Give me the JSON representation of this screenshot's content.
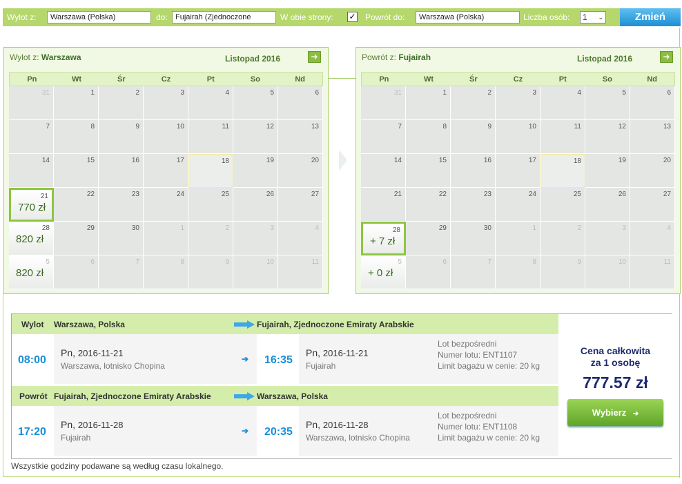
{
  "search": {
    "from_label": "Wylot z:",
    "from_value": "Warszawa (Polska)",
    "to_label": "do:",
    "to_value": "Fujairah (Zjednoczone",
    "roundtrip_label": "W obie strony:",
    "roundtrip_check": "✓",
    "return_label": "Powrót do:",
    "return_value": "Warszawa (Polska)",
    "persons_label": "Liczba osób:",
    "persons_value": "1",
    "change_button": "Zmień"
  },
  "outbound_cal": {
    "from_prefix": "Wylot z:",
    "from_city": "Warszawa",
    "month": "Listopad 2016",
    "weekdays": [
      "Pn",
      "Wt",
      "Śr",
      "Cz",
      "Pt",
      "So",
      "Nd"
    ],
    "weeks": [
      [
        "31",
        "1",
        "2",
        "3",
        "4",
        "5",
        "6"
      ],
      [
        "7",
        "8",
        "9",
        "10",
        "11",
        "12",
        "13"
      ],
      [
        "14",
        "15",
        "16",
        "17",
        "18",
        "19",
        "20"
      ],
      [
        "21",
        "22",
        "23",
        "24",
        "25",
        "26",
        "27"
      ],
      [
        "28",
        "29",
        "30",
        "1",
        "2",
        "3",
        "4"
      ],
      [
        "5",
        "6",
        "7",
        "8",
        "9",
        "10",
        "11"
      ]
    ],
    "prices": {
      "3-0": "770 zł",
      "4-0": "820 zł",
      "5-0": "820 zł"
    }
  },
  "return_cal": {
    "from_prefix": "Powrót z:",
    "from_city": "Fujairah",
    "month": "Listopad 2016",
    "weekdays": [
      "Pn",
      "Wt",
      "Śr",
      "Cz",
      "Pt",
      "So",
      "Nd"
    ],
    "weeks": [
      [
        "31",
        "1",
        "2",
        "3",
        "4",
        "5",
        "6"
      ],
      [
        "7",
        "8",
        "9",
        "10",
        "11",
        "12",
        "13"
      ],
      [
        "14",
        "15",
        "16",
        "17",
        "18",
        "19",
        "20"
      ],
      [
        "21",
        "22",
        "23",
        "24",
        "25",
        "26",
        "27"
      ],
      [
        "28",
        "29",
        "30",
        "1",
        "2",
        "3",
        "4"
      ],
      [
        "5",
        "6",
        "7",
        "8",
        "9",
        "10",
        "11"
      ]
    ],
    "prices": {
      "4-0": "+ 7 zł",
      "5-0": "+ 0 zł"
    }
  },
  "outbound": {
    "title": "Wylot",
    "from": "Warszawa, Polska",
    "to": "Fujairah, Zjednoczone Emiraty Arabskie",
    "dep_time": "08:00",
    "dep_day": "Pn,",
    "dep_date": "2016-11-21",
    "dep_airport": "Warszawa, lotnisko Chopina",
    "arr_time": "16:35",
    "arr_day": "Pn,",
    "arr_date": "2016-11-21",
    "arr_airport": "Fujairah",
    "info1": "Lot bezpośredni",
    "info2": "Numer lotu: ENT1107",
    "info3": "Limit bagażu w cenie: 20 kg"
  },
  "inbound": {
    "title": "Powrót",
    "from": "Fujairah, Zjednoczone Emiraty Arabskie",
    "to": "Warszawa, Polska",
    "dep_time": "17:20",
    "dep_day": "Pn,",
    "dep_date": "2016-11-28",
    "dep_airport": "Fujairah",
    "arr_time": "20:35",
    "arr_day": "Pn,",
    "arr_date": "2016-11-28",
    "arr_airport": "Warszawa, lotnisko Chopina",
    "info1": "Lot bezpośredni",
    "info2": "Numer lotu: ENT1108",
    "info3": "Limit bagażu w cenie: 20 kg"
  },
  "price": {
    "label_line1": "Cena całkowita",
    "label_line2": "za 1 osobę",
    "amount": "777.57 zł",
    "select_button": "Wybierz",
    "button_arrow": "➔"
  },
  "footnote": "Wszystkie godziny podawane są według czasu lokalnego."
}
